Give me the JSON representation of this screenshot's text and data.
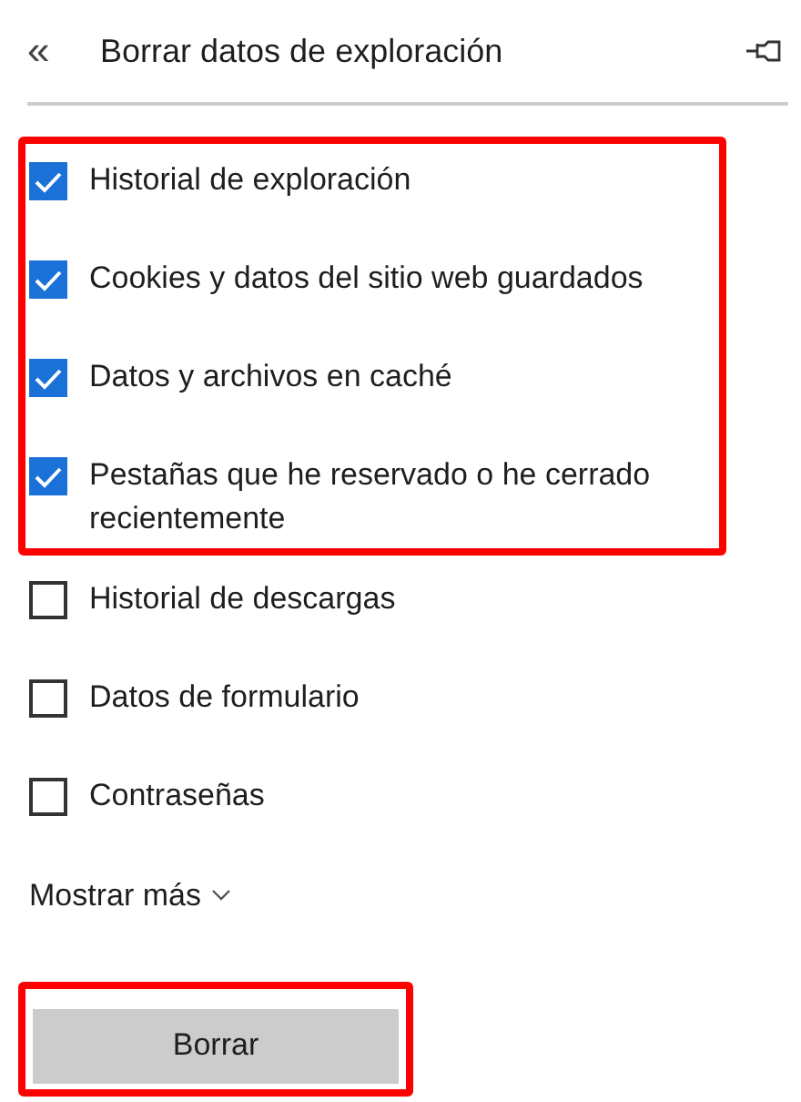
{
  "header": {
    "back_icon": "«",
    "title": "Borrar datos de exploración"
  },
  "option_groups": [
    {
      "highlighted": true,
      "items": [
        {
          "label": "Historial de exploración",
          "checked": true
        },
        {
          "label": "Cookies y datos del sitio web guardados",
          "checked": true
        },
        {
          "label": "Datos y archivos en caché",
          "checked": true
        },
        {
          "label": "Pestañas que he reservado o he cerrado recientemente",
          "checked": true
        }
      ]
    },
    {
      "highlighted": false,
      "items": [
        {
          "label": "Historial de descargas",
          "checked": false
        },
        {
          "label": "Datos de formulario",
          "checked": false
        },
        {
          "label": "Contraseñas",
          "checked": false
        }
      ]
    }
  ],
  "show_more": {
    "label": "Mostrar más"
  },
  "clear_button": {
    "label": "Borrar",
    "highlighted": true
  }
}
